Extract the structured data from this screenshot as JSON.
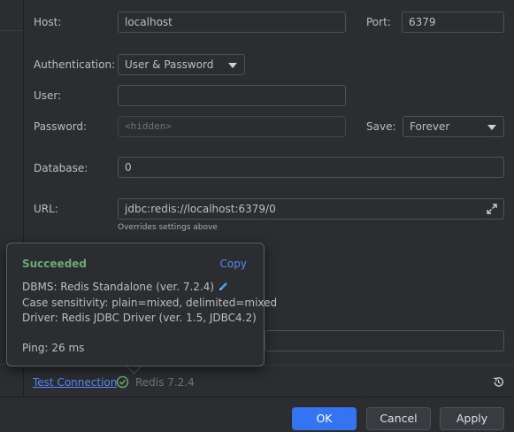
{
  "form": {
    "host_label": "Host:",
    "host_value": "localhost",
    "port_label": "Port:",
    "port_value": "6379",
    "auth_label": "Authentication:",
    "auth_value": "User & Password",
    "user_label": "User:",
    "user_value": "",
    "password_label": "Password:",
    "password_placeholder": "<hidden>",
    "save_label": "Save:",
    "save_value": "Forever",
    "database_label": "Database:",
    "database_value": "0",
    "url_label": "URL:",
    "url_value": "jdbc:redis://localhost:6379/0",
    "url_hint": "Overrides settings above"
  },
  "popup": {
    "status": "Succeeded",
    "copy_label": "Copy",
    "dbms": "DBMS: Redis Standalone (ver. 7.2.4)",
    "case_sensitivity": "Case sensitivity: plain=mixed, delimited=mixed",
    "driver": "Driver: Redis JDBC Driver (ver. 1.5, JDBC4.2)",
    "ping": "Ping: 26 ms"
  },
  "toolbar": {
    "test_connection": "Test Connection",
    "server_version": "Redis 7.2.4"
  },
  "buttons": {
    "ok": "OK",
    "cancel": "Cancel",
    "apply": "Apply"
  },
  "icons": {
    "success": "check-circle-icon",
    "edit": "pencil-icon",
    "expand": "expand-arrows-icon",
    "reset": "history-reset-icon",
    "dropdown": "chevron-down-icon"
  },
  "colors": {
    "success": "#6aab73",
    "link": "#548af7",
    "primary": "#3574f0",
    "pencil": "#3d9be9"
  }
}
